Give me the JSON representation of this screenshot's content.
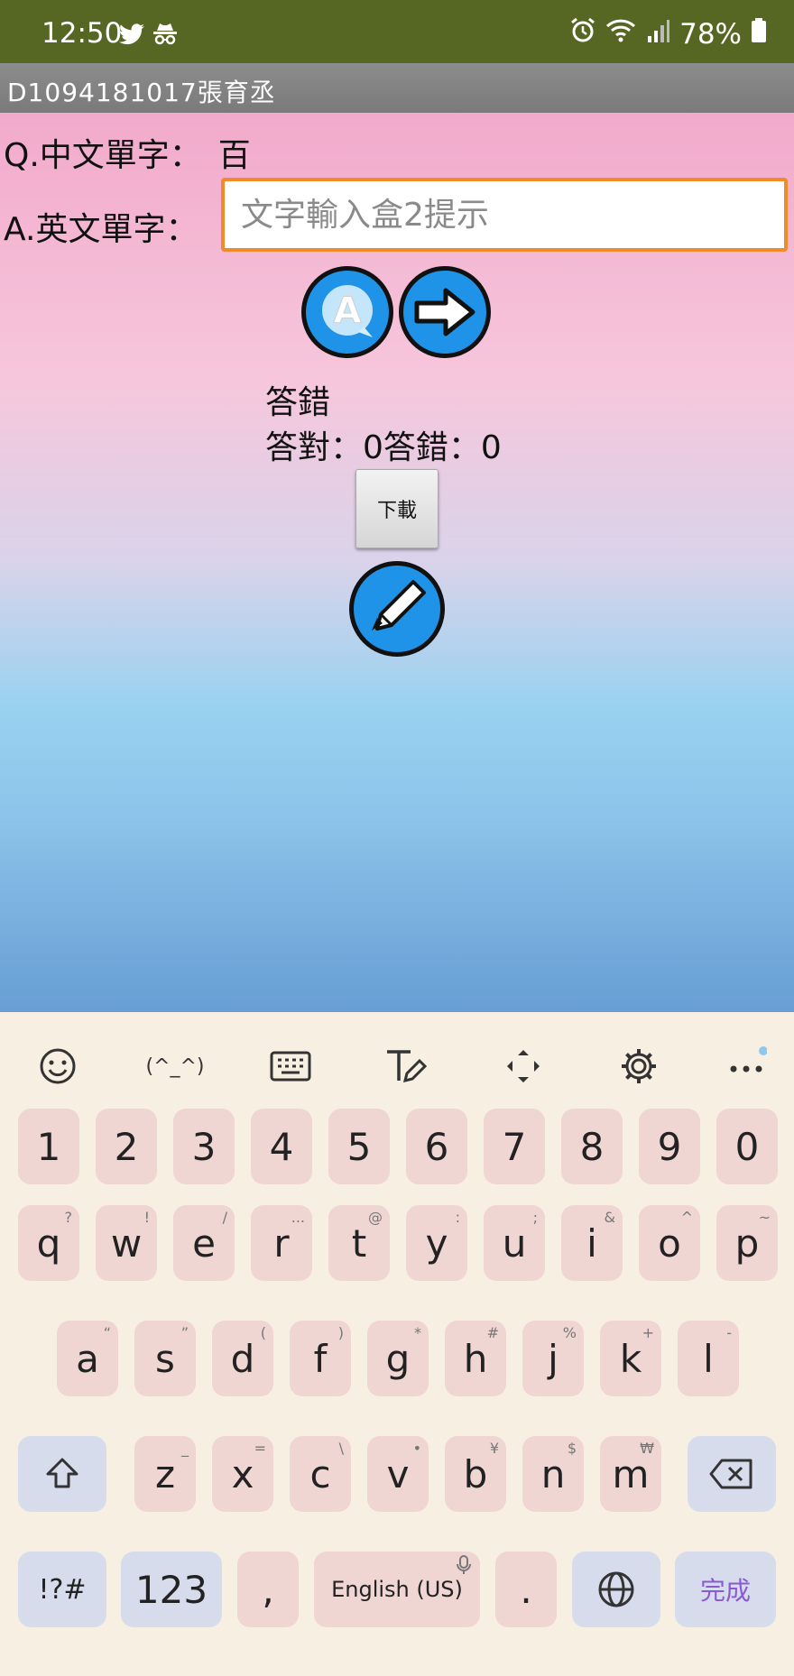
{
  "status_bar": {
    "time": "12:50",
    "battery": "78%",
    "icons": [
      "twitter-icon",
      "incognito-icon",
      "alarm-icon",
      "wifi-icon",
      "signal-icon",
      "battery-icon"
    ]
  },
  "app_title": "D1094181017張育丞",
  "question": {
    "label": "Q.中文單字：",
    "value": "百"
  },
  "answer": {
    "label": "A.英文單字：",
    "placeholder": "文字輸入盒2提示",
    "value": ""
  },
  "result": {
    "message": "答錯",
    "score_text": "答對：0答錯：0"
  },
  "download_label": "下載",
  "toolbar_icons": [
    "emoji-icon",
    "kaomoji-icon",
    "keyboard-icon",
    "handwriting-icon",
    "cursor-move-icon",
    "settings-icon",
    "more-icon"
  ],
  "toolbar_kaomoji": "(^_^)",
  "keyboard": {
    "numbers": [
      "1",
      "2",
      "3",
      "4",
      "5",
      "6",
      "7",
      "8",
      "9",
      "0"
    ],
    "row1": [
      [
        "q",
        "?"
      ],
      [
        "w",
        "!"
      ],
      [
        "e",
        "/"
      ],
      [
        "r",
        "..."
      ],
      [
        "t",
        "@"
      ],
      [
        "y",
        ":"
      ],
      [
        "u",
        ";"
      ],
      [
        "i",
        "&"
      ],
      [
        "o",
        "^"
      ],
      [
        "p",
        "~"
      ]
    ],
    "row2": [
      [
        "a",
        "“"
      ],
      [
        "s",
        "”"
      ],
      [
        "d",
        "("
      ],
      [
        "f",
        ")"
      ],
      [
        "g",
        "*"
      ],
      [
        "h",
        "#"
      ],
      [
        "j",
        "%"
      ],
      [
        "k",
        "+"
      ],
      [
        "l",
        "-"
      ]
    ],
    "row3": [
      [
        "z",
        "_"
      ],
      [
        "x",
        "="
      ],
      [
        "c",
        "\\"
      ],
      [
        "v",
        "•"
      ],
      [
        "b",
        "¥"
      ],
      [
        "n",
        "$"
      ],
      [
        "m",
        "₩"
      ]
    ],
    "symbols_key": "!?#",
    "numbers_key": "123",
    "comma": ",",
    "space": "English (US)",
    "period": ".",
    "done": "完成"
  },
  "colors": {
    "status_bar": "#566623",
    "title_bar": "#858585",
    "input_border": "#f08a2a",
    "icon_button": "#1f93e8",
    "keyboard_bg": "#f8efe3",
    "key_bg": "#f0d6d3",
    "func_key_bg": "#d7dcec",
    "done_text": "#8a5ad6"
  }
}
